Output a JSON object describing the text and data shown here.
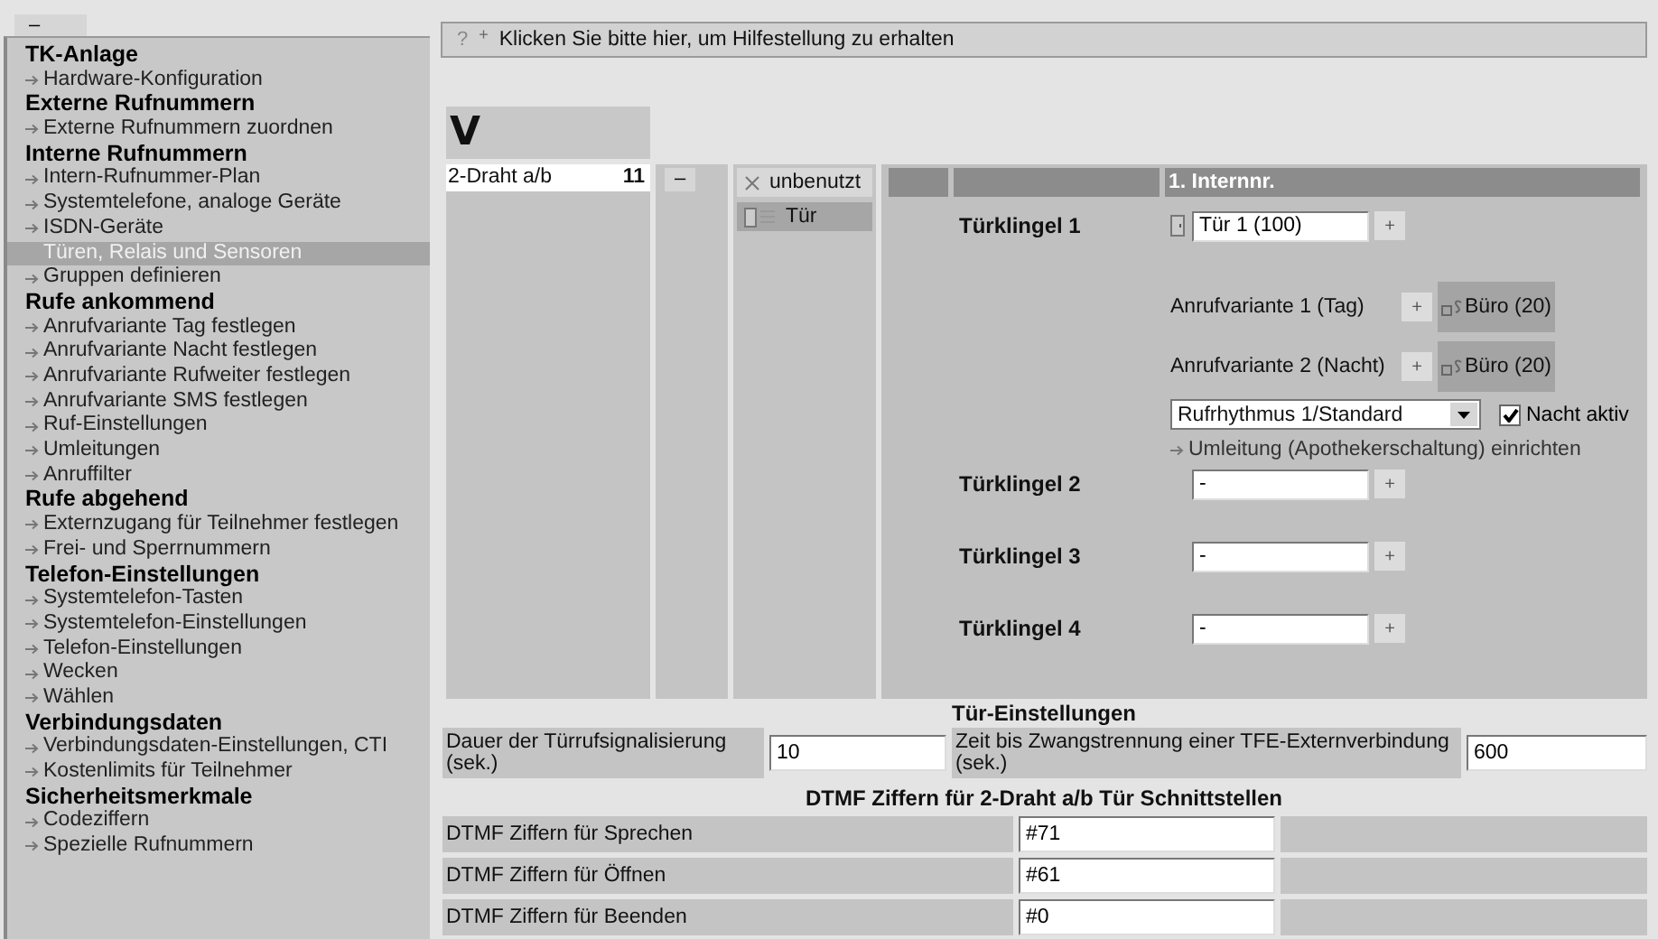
{
  "sidebar": {
    "toggle": "–",
    "sections": [
      {
        "title": "TK-Anlage",
        "items": [
          {
            "label": "Hardware-Konfiguration",
            "selected": false
          }
        ]
      },
      {
        "title": "Externe Rufnummern",
        "items": [
          {
            "label": "Externe Rufnummern zuordnen",
            "selected": false
          }
        ]
      },
      {
        "title": "Interne Rufnummern",
        "items": [
          {
            "label": "Intern-Rufnummer-Plan",
            "selected": false
          },
          {
            "label": "Systemtelefone, analoge Geräte",
            "selected": false
          },
          {
            "label": "ISDN-Geräte",
            "selected": false
          },
          {
            "label": "Türen, Relais und Sensoren",
            "selected": true
          },
          {
            "label": "Gruppen definieren",
            "selected": false
          }
        ]
      },
      {
        "title": "Rufe ankommend",
        "items": [
          {
            "label": "Anrufvariante Tag festlegen",
            "selected": false
          },
          {
            "label": "Anrufvariante Nacht festlegen",
            "selected": false
          },
          {
            "label": "Anrufvariante Rufweiter festlegen",
            "selected": false
          },
          {
            "label": "Anrufvariante SMS festlegen",
            "selected": false
          },
          {
            "label": "Ruf-Einstellungen",
            "selected": false
          },
          {
            "label": "Umleitungen",
            "selected": false
          },
          {
            "label": "Anruffilter",
            "selected": false
          }
        ]
      },
      {
        "title": "Rufe abgehend",
        "items": [
          {
            "label": "Externzugang für Teilnehmer festlegen",
            "selected": false
          },
          {
            "label": "Frei- und Sperrnummern",
            "selected": false
          }
        ]
      },
      {
        "title": "Telefon-Einstellungen",
        "items": [
          {
            "label": "Systemtelefon-Tasten",
            "selected": false
          },
          {
            "label": "Systemtelefon-Einstellungen",
            "selected": false
          },
          {
            "label": "Telefon-Einstellungen",
            "selected": false
          },
          {
            "label": "Wecken",
            "selected": false
          },
          {
            "label": "Wählen",
            "selected": false
          }
        ]
      },
      {
        "title": "Verbindungsdaten",
        "items": [
          {
            "label": "Verbindungsdaten-Einstellungen, CTI",
            "selected": false
          },
          {
            "label": "Kostenlimits für Teilnehmer",
            "selected": false
          }
        ]
      },
      {
        "title": "Sicherheitsmerkmale",
        "items": [
          {
            "label": "Codeziffern",
            "selected": false
          },
          {
            "label": "Spezielle Rufnummern",
            "selected": false
          }
        ]
      }
    ]
  },
  "help_bar": {
    "icon": "?",
    "expand": "+",
    "text": "Klicken Sie bitte hier, um Hilfestellung zu erhalten"
  },
  "port_header": "V",
  "ports": [
    {
      "name": "2-Draht a/b",
      "number": "11"
    }
  ],
  "collapse_button": "–",
  "usage_options": [
    {
      "label": "unbenutzt",
      "kind": "unused",
      "selected": false
    },
    {
      "label": "Tür",
      "kind": "door",
      "selected": true
    }
  ],
  "bells_header": "1. Internnr.",
  "bells": [
    {
      "label": "Türklingel 1",
      "kind": "assigned",
      "value": "Tür 1 (100)",
      "add": "+",
      "variants": [
        {
          "label": "Anrufvariante 1 (Tag)",
          "add": "+",
          "target": "Büro (20)"
        },
        {
          "label": "Anrufvariante 2 (Nacht)",
          "add": "+",
          "target": "Büro (20)"
        }
      ],
      "ring_rhythm": "Rufrhythmus 1/Standard",
      "night_active": {
        "label": "Nacht aktiv",
        "checked": true
      },
      "link": "Umleitung (Apothekerschaltung) einrichten"
    },
    {
      "label": "Türklingel 2",
      "kind": "empty",
      "value": "-",
      "add": "+"
    },
    {
      "label": "Türklingel 3",
      "kind": "empty",
      "value": "-",
      "add": "+"
    },
    {
      "label": "Türklingel 4",
      "kind": "empty",
      "value": "-",
      "add": "+"
    }
  ],
  "door_settings": {
    "title": "Tür-Einstellungen",
    "fields": [
      {
        "label": "Dauer der Türrufsignalisierung (sek.)",
        "value": "10"
      },
      {
        "label": "Zeit bis Zwangstrennung einer TFE-Externverbindung (sek.)",
        "value": "600"
      }
    ]
  },
  "dtmf": {
    "title": "DTMF Ziffern für 2-Draht a/b Tür Schnittstellen",
    "rows": [
      {
        "label": "DTMF Ziffern für Sprechen",
        "value": "#71"
      },
      {
        "label": "DTMF Ziffern für Öffnen",
        "value": "#61"
      },
      {
        "label": "DTMF Ziffern für Beenden",
        "value": "#0"
      }
    ]
  }
}
